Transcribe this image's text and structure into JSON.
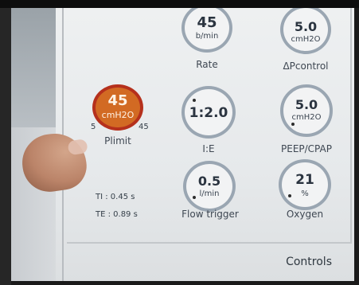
{
  "knobs": {
    "rate": {
      "value": "45",
      "unit": "b/min",
      "label": "Rate"
    },
    "delta_p": {
      "value": "5.0",
      "unit": "cmH2O",
      "label": "ΔPcontrol"
    },
    "plimit": {
      "value": "45",
      "unit": "cmH2O",
      "label": "Plimit",
      "min": "5",
      "max": "45"
    },
    "ie": {
      "value": "1:2.0",
      "label": "I:E"
    },
    "peep": {
      "value": "5.0",
      "unit": "cmH2O",
      "label": "PEEP/CPAP"
    },
    "flow_trigger": {
      "value": "0.5",
      "unit": "l/min",
      "label": "Flow trigger"
    },
    "oxygen": {
      "value": "21",
      "unit": "%",
      "label": "Oxygen"
    }
  },
  "timing": {
    "ti": "TI : 0.45 s",
    "te": "TE : 0.89 s"
  },
  "footer": {
    "controls": "Controls"
  },
  "colors": {
    "active_fill": "#d26a23",
    "active_ring": "#b5301c",
    "ring": "#9aa6b2",
    "background": "#e6e9eb"
  }
}
